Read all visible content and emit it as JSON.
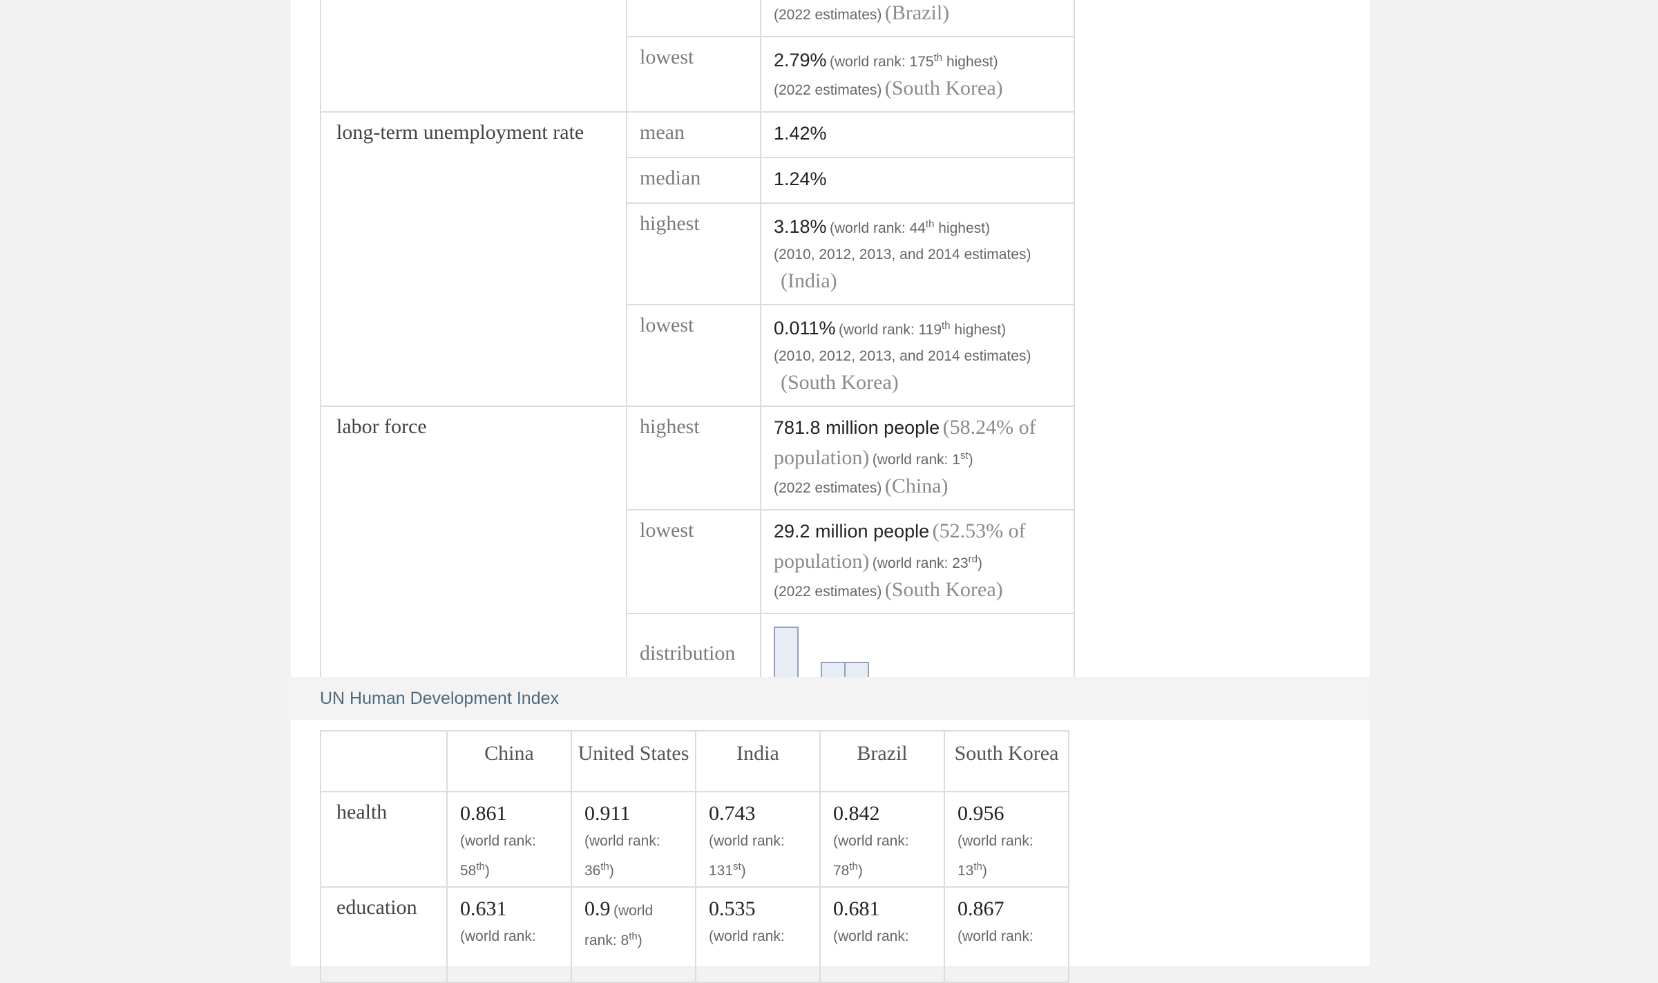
{
  "table1": {
    "row0": {
      "note": "(2022 estimates)",
      "country": "(Brazil)"
    },
    "row0_lowest": {
      "label": "lowest",
      "value": "2.79%",
      "rank_prefix": "(world rank: 175",
      "rank_sup": "th",
      "rank_suffix": " highest)",
      "note": "(2022 estimates)",
      "country": "(South Korea)"
    },
    "long_term": {
      "label": "long-term unemployment rate",
      "mean_label": "mean",
      "mean_value": "1.42%",
      "median_label": "median",
      "median_value": "1.24%",
      "highest_label": "highest",
      "highest_value": "3.18%",
      "highest_rank_prefix": "(world rank: 44",
      "highest_rank_sup": "th",
      "highest_rank_suffix": " highest)",
      "highest_note": "(2010, 2012, 2013, and 2014 estimates)",
      "highest_country": "(India)",
      "lowest_label": "lowest",
      "lowest_value": "0.011%",
      "lowest_rank_prefix": "(world rank: 119",
      "lowest_rank_sup": "th",
      "lowest_rank_suffix": " highest)",
      "lowest_note": "(2010, 2012, 2013, and 2014 estimates)",
      "lowest_country": "(South Korea)"
    },
    "labor_force": {
      "label": "labor force",
      "highest_label": "highest",
      "highest_value": "781.8 million people",
      "highest_pop": "(58.24% of population)",
      "highest_rank_prefix": "(world rank: 1",
      "highest_rank_sup": "st",
      "highest_rank_suffix": ")",
      "highest_note": "(2022 estimates)",
      "highest_country": "(China)",
      "lowest_label": "lowest",
      "lowest_value": "29.2 million people",
      "lowest_pop": "(52.53% of population)",
      "lowest_rank_prefix": "(world rank: 23",
      "lowest_rank_sup": "rd",
      "lowest_rank_suffix": ")",
      "lowest_note": "(2022 estimates)",
      "lowest_country": "(South Korea)",
      "distribution_label": "distribution",
      "distribution_counts": [
        3,
        0,
        1,
        1
      ]
    }
  },
  "section2": {
    "title": "UN Human Development Index"
  },
  "table2": {
    "columns": [
      "China",
      "United States",
      "India",
      "Brazil",
      "South Korea"
    ],
    "rows": [
      {
        "label": "health",
        "cells": [
          {
            "value": "0.861",
            "rank": "58",
            "sup": "th"
          },
          {
            "value": "0.911",
            "rank": "36",
            "sup": "th"
          },
          {
            "value": "0.743",
            "rank": "131",
            "sup": "st"
          },
          {
            "value": "0.842",
            "rank": "78",
            "sup": "th"
          },
          {
            "value": "0.956",
            "rank": "13",
            "sup": "th"
          }
        ]
      },
      {
        "label": "education",
        "cells": [
          {
            "value": "0.631",
            "rank_text": "(world rank:"
          },
          {
            "value": "0.9",
            "rank_text": "(world rank: 8",
            "sup": "th"
          },
          {
            "value": "0.535",
            "rank_text": "(world rank:"
          },
          {
            "value": "0.681",
            "rank_text": "(world rank:"
          },
          {
            "value": "0.867",
            "rank_text": "(world rank:"
          }
        ]
      }
    ]
  }
}
